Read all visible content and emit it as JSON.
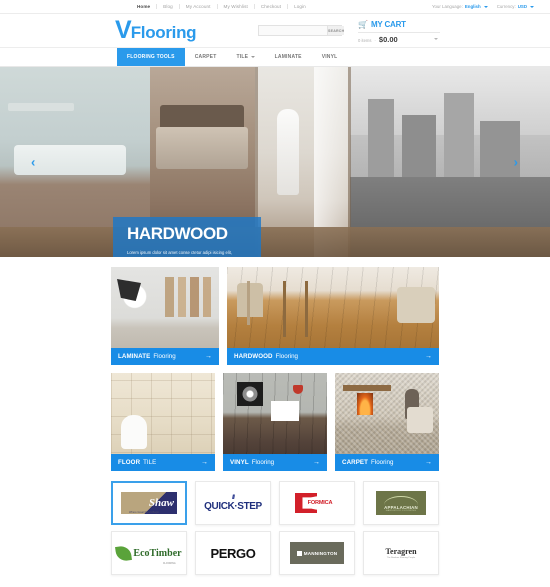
{
  "topbar": {
    "nav": [
      {
        "label": "Home",
        "active": true
      },
      {
        "label": "Blog",
        "active": false
      },
      {
        "label": "My Account",
        "active": false
      },
      {
        "label": "My Wishlist",
        "active": false
      },
      {
        "label": "Checkout",
        "active": false
      },
      {
        "label": "Login",
        "active": false
      }
    ],
    "language_label": "Your Language:",
    "language_value": "English",
    "currency_label": "Currency:",
    "currency_value": "USD"
  },
  "header": {
    "logo_mark": "V",
    "logo_word": "Flooring",
    "search_value": "",
    "search_placeholder": "",
    "search_button": "SEARCH",
    "cart_icon": "cart-icon",
    "cart_title": "MY CART",
    "cart_items": "0 items",
    "cart_dash": "-",
    "cart_total": "$0.00"
  },
  "mainnav": [
    {
      "label": "FLOORING TOOLS",
      "active": true,
      "caret": false
    },
    {
      "label": "CARPET",
      "active": false,
      "caret": false
    },
    {
      "label": "TILE",
      "active": false,
      "caret": true
    },
    {
      "label": "LAMINATE",
      "active": false,
      "caret": false
    },
    {
      "label": "VINYL",
      "active": false,
      "caret": false
    }
  ],
  "hero": {
    "title": "HARDWOOD",
    "body": "Lorem ipsum dolor sit amet conse ctetur adipi isicing elit, sed do eiusmod tempor incididunt ut labore et dolore magna",
    "arrow": "→",
    "prev": "‹",
    "next": "›"
  },
  "tiles": {
    "row1": [
      {
        "bold": "LAMINATE",
        "normal": "Flooring",
        "arrow": "→",
        "art": "img-laminate"
      },
      {
        "bold": "HARDWOOD",
        "normal": "Flooring",
        "arrow": "→",
        "art": "img-hardwood"
      }
    ],
    "row2": [
      {
        "bold": "FLOOR",
        "normal": "TILE",
        "arrow": "→",
        "art": "img-tile"
      },
      {
        "bold": "VINYL",
        "normal": "Flooring",
        "arrow": "→",
        "art": "img-vinyl"
      },
      {
        "bold": "CARPET",
        "normal": "Flooring",
        "arrow": "→",
        "art": "img-carpet"
      }
    ]
  },
  "brands": {
    "row1": [
      {
        "name": "Shaw",
        "tagline": "Where Great Floors Begin",
        "selected": true
      },
      {
        "name": "QUICK·STEP",
        "tagline": "",
        "selected": false
      },
      {
        "name": "FORMICA",
        "tagline": "",
        "selected": false
      },
      {
        "name": "APPALACHIAN",
        "tagline": "HARDWOOD FLOORING",
        "selected": false
      }
    ],
    "row2": [
      {
        "name": "EcoTimber",
        "tagline": "FLOORING",
        "selected": false
      },
      {
        "name": "PERGO",
        "tagline": "",
        "selected": false
      },
      {
        "name": "MANNINGTON",
        "tagline": "",
        "selected": false
      },
      {
        "name": "Teragren",
        "tagline": "The Bamboo Flooring People",
        "selected": false
      }
    ]
  },
  "colors": {
    "accent": "#2a9aeb",
    "tile_caption": "#188ce6",
    "hero_overlay": "#1c78c8"
  }
}
